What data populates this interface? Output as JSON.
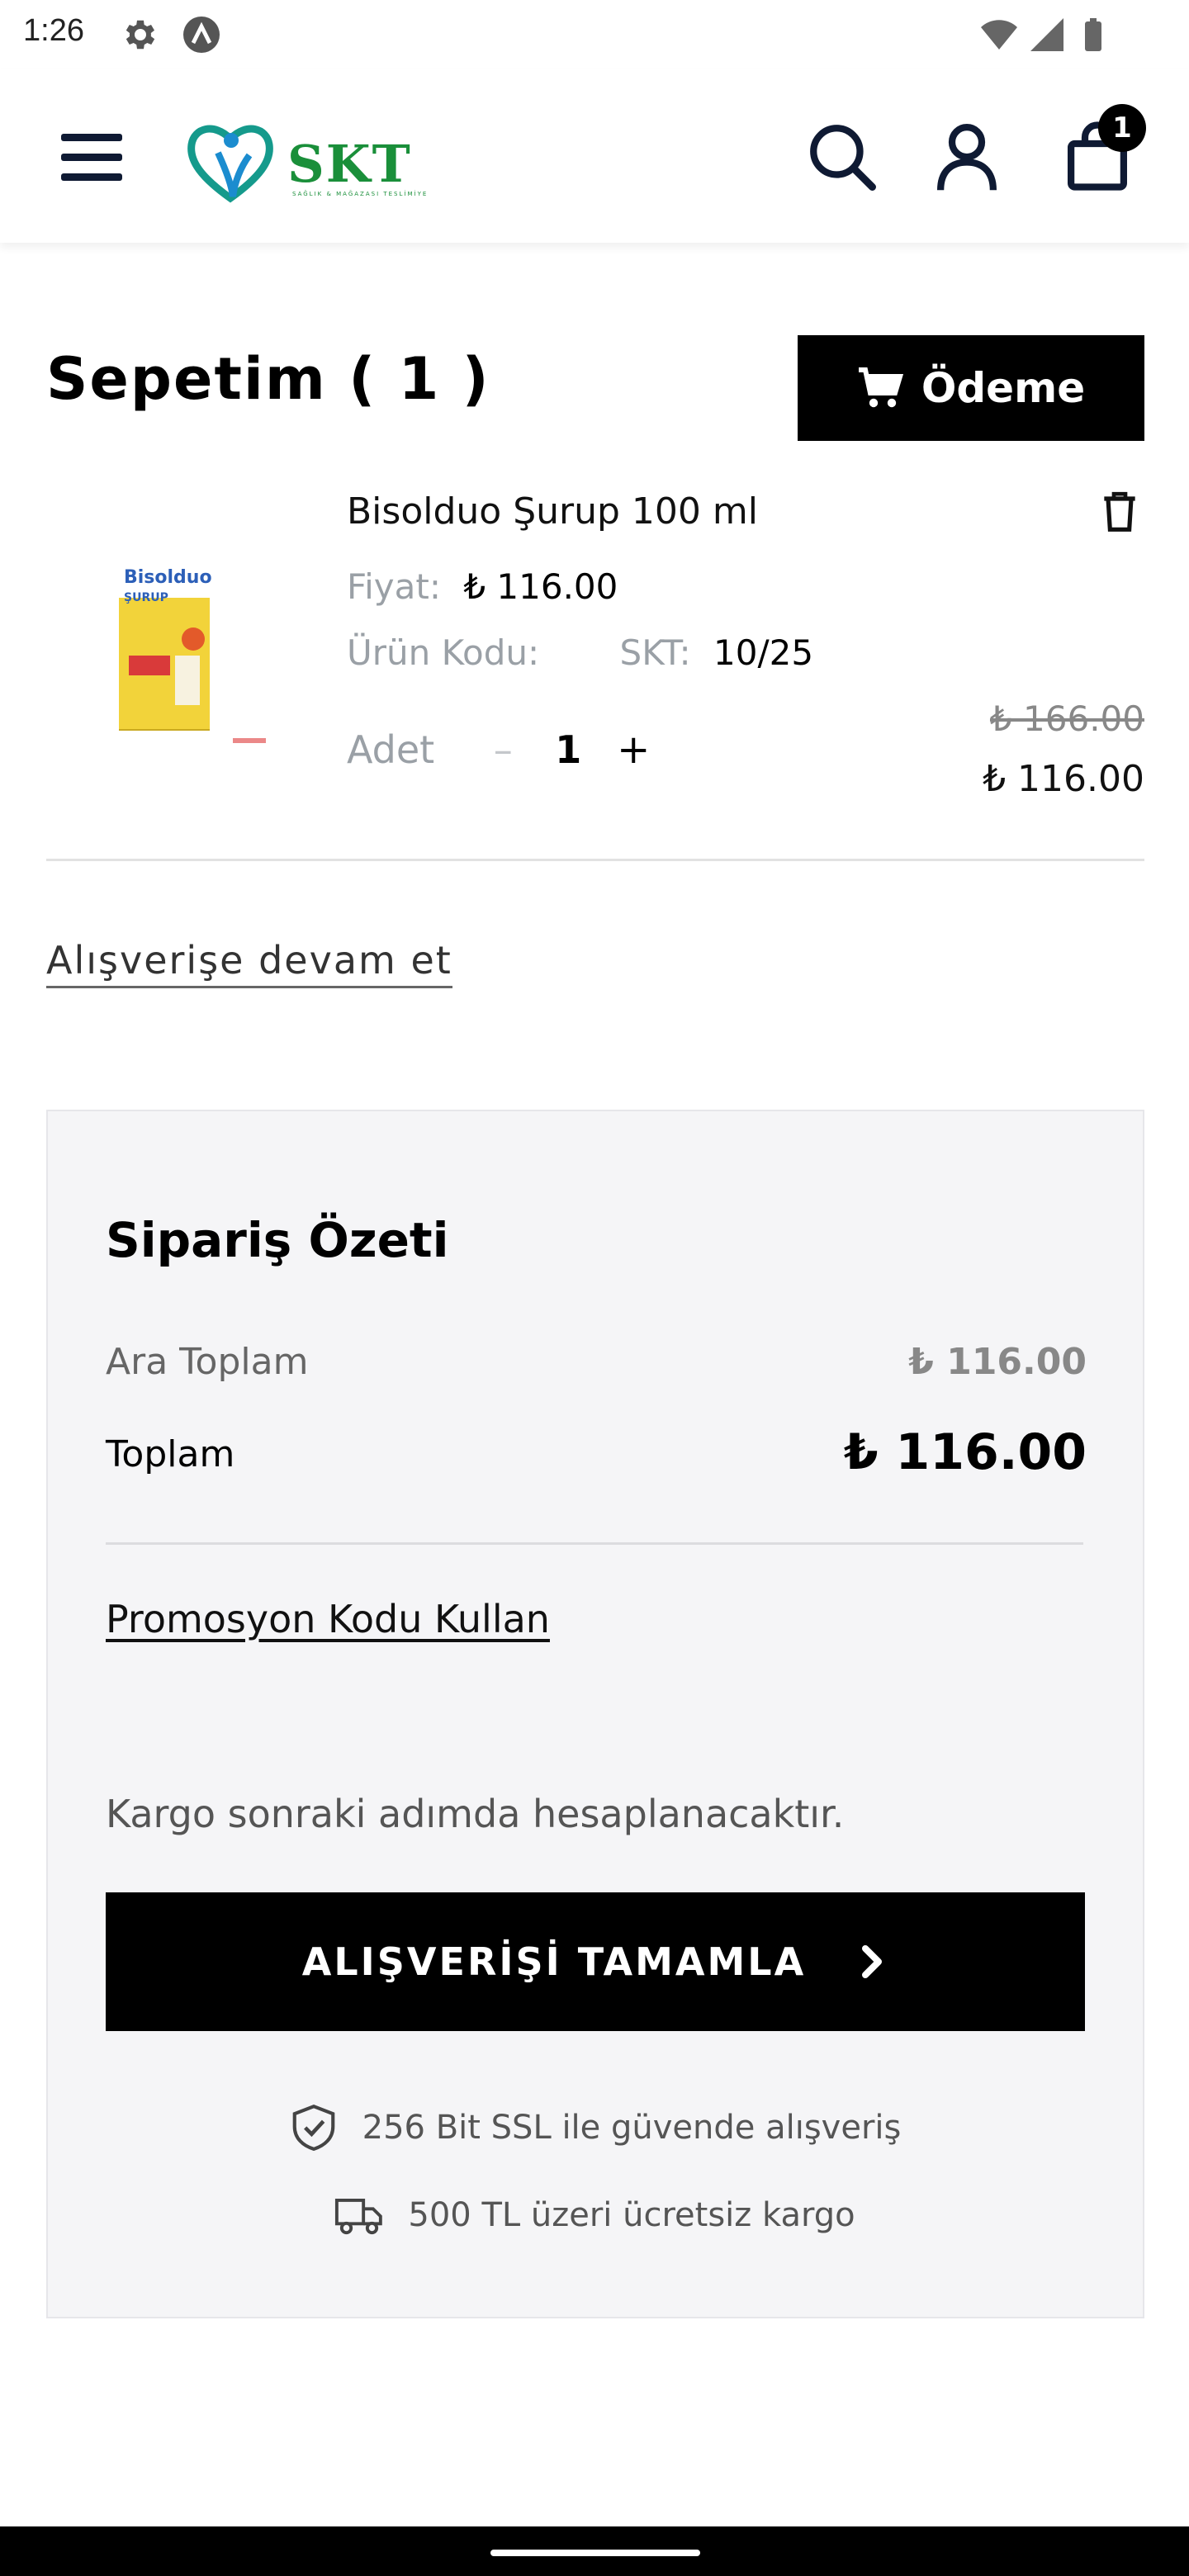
{
  "status_bar": {
    "time": "1:26"
  },
  "header": {
    "logo_text": "SKT",
    "logo_tagline": "SAĞLIK & MAĞAZASI TESLİMİYE",
    "cart_count": "1",
    "colors": {
      "logo_green": "#1a8f3a",
      "logo_blue": "#1b8ccf",
      "logo_teal": "#159a8c"
    }
  },
  "cart": {
    "title": "Sepetim ( 1 )",
    "checkout_label": "Ödeme",
    "item": {
      "name": "Bisolduo Şurup 100 ml",
      "image_brand": "Bisolduo",
      "image_sub": "ŞURUP",
      "price_label": "Fiyat:",
      "price_value": "₺ 116.00",
      "code_label": "Ürün Kodu:",
      "skt_label": "SKT:",
      "skt_value": "10/25",
      "qty_label": "Adet",
      "qty_minus": "–",
      "qty_value": "1",
      "qty_plus": "+",
      "old_price": "₺ 166.00",
      "new_price": "₺ 116.00"
    },
    "continue_label": "Alışverişe devam et"
  },
  "summary": {
    "title": "Sipariş Özeti",
    "subtotal_label": "Ara Toplam",
    "subtotal_value": "₺ 116.00",
    "total_label": "Toplam",
    "total_value": "₺ 116.00",
    "promo_label": "Promosyon Kodu Kullan",
    "cargo_note": "Kargo sonraki adımda hesaplanacaktır.",
    "complete_label": "ALIŞVERİŞİ TAMAMLA",
    "ssl_text": "256 Bit SSL ile güvende alışveriş",
    "shipping_text": "500 TL üzeri ücretsiz kargo"
  },
  "icons": {
    "menu": "hamburger-icon",
    "search": "search-icon",
    "account": "user-icon",
    "cart": "shopping-bag-icon",
    "trash": "trash-icon",
    "cart_small": "cart-icon",
    "chevron": "chevron-right-icon",
    "shield": "shield-check-icon",
    "truck": "truck-icon"
  }
}
